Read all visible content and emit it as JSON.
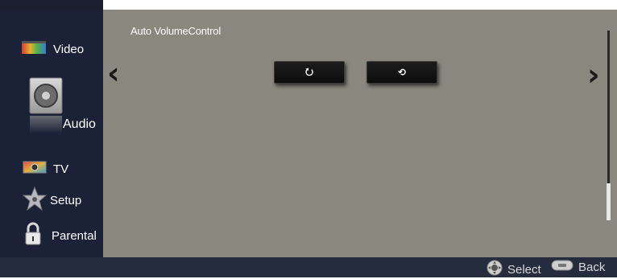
{
  "sidebar": {
    "items": [
      {
        "label": "Video",
        "icon": "video-icon"
      },
      {
        "label": "Audio",
        "icon": "speaker-icon"
      },
      {
        "label": "TV",
        "icon": "tv-icon"
      },
      {
        "label": "Setup",
        "icon": "setup-icon"
      },
      {
        "label": "Parental",
        "icon": "lock-icon"
      }
    ],
    "selected": "Audio"
  },
  "panel": {
    "title": "Auto VolumeControl",
    "options": [
      {
        "label": "⭮",
        "state": "off"
      },
      {
        "label": "⟲",
        "state": "on"
      }
    ]
  },
  "footer": {
    "select_label": "Select",
    "back_label": "Back"
  },
  "colors": {
    "sidebar_bg": "#1b2238",
    "panel_bg": "#8a877e",
    "button_bg": "#111111",
    "footer_bg": "#242c3e"
  }
}
